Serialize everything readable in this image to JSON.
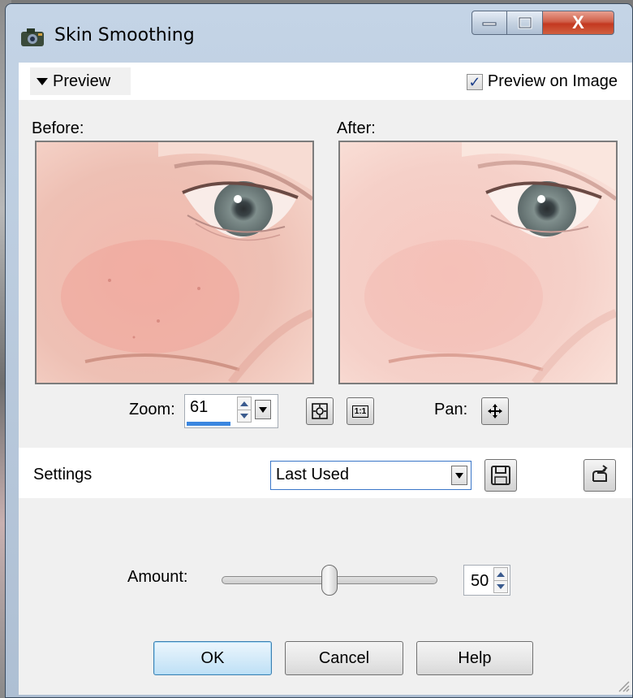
{
  "window": {
    "title": "Skin Smoothing",
    "controls": {
      "minimize": "—",
      "maximize": "□",
      "close": "X"
    }
  },
  "preview": {
    "toggle_label": "Preview",
    "preview_on_image_label": "Preview on Image",
    "preview_on_image_checked": true,
    "before_label": "Before:",
    "after_label": "After:"
  },
  "zoom": {
    "label": "Zoom:",
    "value": "61",
    "zoom_fit_icon": "zoom-to-fit-icon",
    "actual_size_text": "1:1",
    "pan_label": "Pan:",
    "pan_icon": "move-cross-icon"
  },
  "settings": {
    "label": "Settings",
    "selected": "Last Used",
    "save_icon": "floppy-disk-icon",
    "reset_icon": "reset-hand-icon"
  },
  "amount": {
    "label": "Amount:",
    "value": "50",
    "slider_fraction": 0.5
  },
  "buttons": {
    "ok": "OK",
    "cancel": "Cancel",
    "help": "Help"
  },
  "colors": {
    "accent": "#3a86e0",
    "close_button": "#c43820",
    "skin_before": "#f0bfb6",
    "skin_after": "#f6d2cc"
  }
}
